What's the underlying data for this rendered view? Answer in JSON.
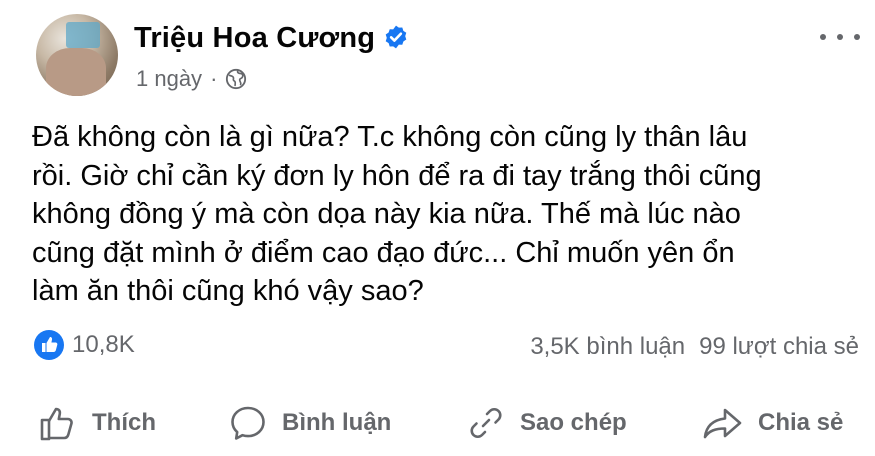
{
  "post": {
    "author": "Triệu Hoa Cương",
    "time": "1 ngày",
    "separator": "·",
    "text": "Đã không còn là gì nữa? T.c không còn cũng ly thân lâu\nrồi. Giờ chỉ cần ký đơn ly hôn để ra đi tay trắng thôi cũng\nkhông đồng ý mà còn dọa này kia nữa. Thế mà lúc nào\ncũng đặt mình ở điểm cao đạo đức... Chỉ muốn yên ổn\nlàm ăn thôi cũng khó vậy sao?"
  },
  "stats": {
    "reactions": "10,8K",
    "comments": "3,5K bình luận",
    "shares": "99 lượt chia sẻ"
  },
  "actions": {
    "like": "Thích",
    "comment": "Bình luận",
    "copy": "Sao chép",
    "share": "Chia sẻ"
  },
  "colors": {
    "brand_blue": "#1877f2",
    "secondary_text": "#65676b",
    "primary_text": "#050505"
  },
  "icons": {
    "verified": "verified-badge-icon",
    "privacy": "globe-icon",
    "more": "more-options-icon",
    "reaction": "like-reaction-icon",
    "like": "thumbs-up-icon",
    "comment": "comment-bubble-icon",
    "copy": "link-icon",
    "share": "share-arrow-icon"
  }
}
